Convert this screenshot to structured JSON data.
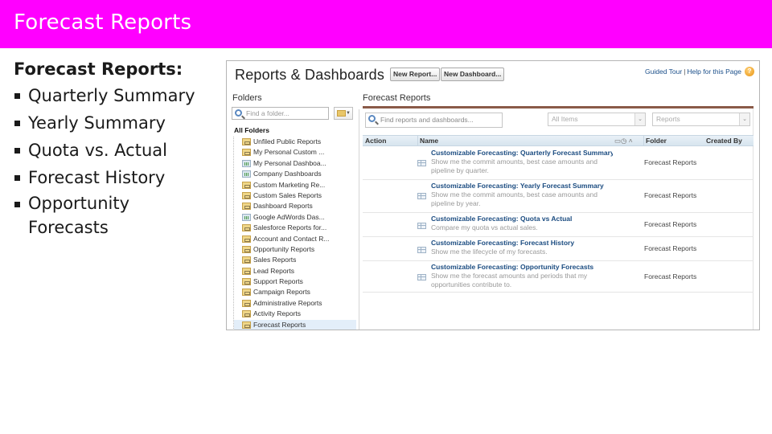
{
  "slide": {
    "title": "Forecast Reports",
    "title_bar_color": "#ff00ff",
    "heading": "Forecast Reports:",
    "bullets": [
      "Quarterly Summary",
      "Yearly Summary",
      "Quota vs. Actual",
      "Forecast History",
      "Opportunity Forecasts"
    ]
  },
  "app": {
    "title": "Reports & Dashboards",
    "buttons": {
      "new_report": "New Report...",
      "new_dashboard": "New Dashboard..."
    },
    "top_links": {
      "guided_tour": "Guided Tour",
      "separator": "|",
      "help": "Help for this Page",
      "help_icon": "?"
    },
    "folders": {
      "label": "Folders",
      "search_placeholder": "Find a folder...",
      "all_folders": "All Folders",
      "items": [
        {
          "label": "Unfiled Public Reports",
          "icon": "folder-icon"
        },
        {
          "label": "My Personal Custom ...",
          "icon": "folder-icon"
        },
        {
          "label": "My Personal Dashboa...",
          "icon": "dashboard-folder-icon"
        },
        {
          "label": "Company Dashboards",
          "icon": "dashboard-folder-icon"
        },
        {
          "label": "Custom Marketing Re...",
          "icon": "folder-icon"
        },
        {
          "label": "Custom Sales Reports",
          "icon": "folder-icon"
        },
        {
          "label": "Dashboard Reports",
          "icon": "folder-icon"
        },
        {
          "label": "Google AdWords Das...",
          "icon": "dashboard-folder-icon"
        },
        {
          "label": "Salesforce Reports for...",
          "icon": "folder-icon"
        },
        {
          "label": "Account and Contact R...",
          "icon": "folder-icon"
        },
        {
          "label": "Opportunity Reports",
          "icon": "folder-icon"
        },
        {
          "label": "Sales Reports",
          "icon": "folder-icon"
        },
        {
          "label": "Lead Reports",
          "icon": "folder-icon"
        },
        {
          "label": "Support Reports",
          "icon": "folder-icon"
        },
        {
          "label": "Campaign Reports",
          "icon": "folder-icon"
        },
        {
          "label": "Administrative Reports",
          "icon": "folder-icon"
        },
        {
          "label": "Activity Reports",
          "icon": "folder-icon"
        },
        {
          "label": "Forecast Reports",
          "icon": "folder-icon",
          "selected": true
        }
      ]
    },
    "main": {
      "folder_title": "Forecast Reports",
      "search_placeholder": "Find reports and dashboards...",
      "filter_type": "All Items",
      "filter_kind": "Reports",
      "columns": {
        "action": "Action",
        "name": "Name",
        "folder": "Folder",
        "created_by": "Created By"
      },
      "rows": [
        {
          "name": "Customizable Forecasting: Quarterly Forecast Summary",
          "description": "Show me the commit amounts, best case amounts and pipeline by quarter.",
          "folder": "Forecast Reports"
        },
        {
          "name": "Customizable Forecasting: Yearly Forecast Summary",
          "description": "Show me the commit amounts, best case amounts and pipeline by year.",
          "folder": "Forecast Reports"
        },
        {
          "name": "Customizable Forecasting: Quota vs Actual",
          "description": "Compare my quota vs actual sales.",
          "folder": "Forecast Reports"
        },
        {
          "name": "Customizable Forecasting: Forecast History",
          "description": "Show me the lifecycle of my forecasts.",
          "folder": "Forecast Reports"
        },
        {
          "name": "Customizable Forecasting: Opportunity Forecasts",
          "description": "Show me the forecast amounts and periods that my opportunities contribute to.",
          "folder": "Forecast Reports"
        }
      ]
    }
  }
}
